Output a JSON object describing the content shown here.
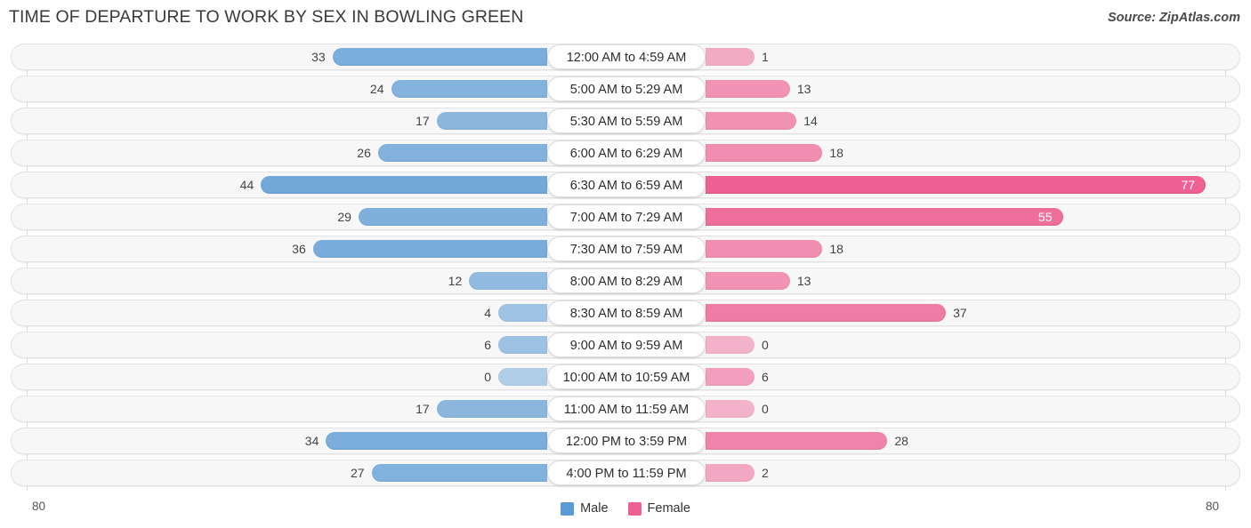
{
  "header": {
    "title": "TIME OF DEPARTURE TO WORK BY SEX IN BOWLING GREEN",
    "source": "Source: ZipAtlas.com"
  },
  "axis": {
    "left_max": "80",
    "right_max": "80"
  },
  "legend": {
    "items": [
      {
        "label": "Male",
        "color": "#5b9bd5"
      },
      {
        "label": "Female",
        "color": "#ef5f92"
      }
    ]
  },
  "chart_data": {
    "type": "bar",
    "orientation": "horizontal-diverging",
    "title": "TIME OF DEPARTURE TO WORK BY SEX IN BOWLING GREEN",
    "xlabel": "",
    "ylabel": "",
    "xlim": [
      80,
      80
    ],
    "grid": false,
    "legend_position": "bottom-center",
    "categories": [
      "12:00 AM to 4:59 AM",
      "5:00 AM to 5:29 AM",
      "5:30 AM to 5:59 AM",
      "6:00 AM to 6:29 AM",
      "6:30 AM to 6:59 AM",
      "7:00 AM to 7:29 AM",
      "7:30 AM to 7:59 AM",
      "8:00 AM to 8:29 AM",
      "8:30 AM to 8:59 AM",
      "9:00 AM to 9:59 AM",
      "10:00 AM to 10:59 AM",
      "11:00 AM to 11:59 AM",
      "12:00 PM to 3:59 PM",
      "4:00 PM to 11:59 PM"
    ],
    "series": [
      {
        "name": "Male",
        "color": "#5b9bd5",
        "side": "left",
        "values": [
          33,
          24,
          17,
          26,
          44,
          29,
          36,
          12,
          4,
          6,
          0,
          17,
          34,
          27
        ]
      },
      {
        "name": "Female",
        "color": "#ef5f92",
        "side": "right",
        "values": [
          1,
          13,
          14,
          18,
          77,
          55,
          18,
          13,
          37,
          0,
          6,
          0,
          28,
          2
        ]
      }
    ]
  }
}
